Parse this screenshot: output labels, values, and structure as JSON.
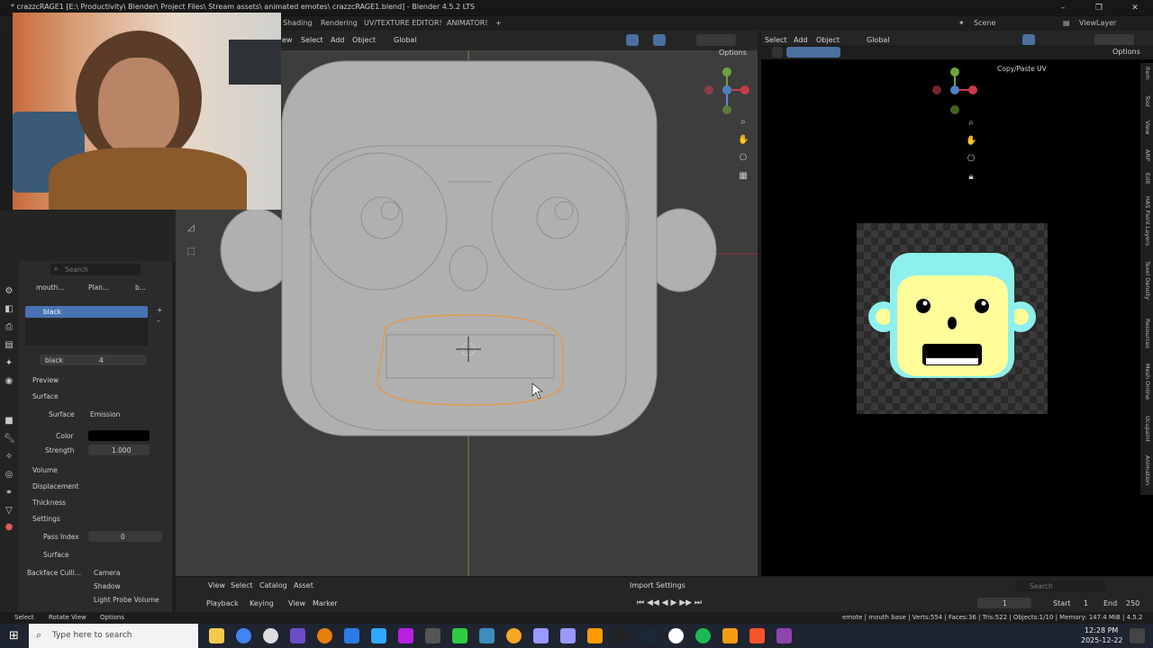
{
  "window": {
    "title": "* crazzcRAGE1 [E:\\ Productivity\\ Blender\\ Project Files\\ Stream assets\\ animated emotes\\ crazzcRAGE1.blend] - Blender 4.5.2 LTS"
  },
  "workspaces": [
    "Shading",
    "Rendering",
    "UV/TEXTURE EDITOR!",
    "ANIMATOR!"
  ],
  "workspace_add": "+",
  "scene": "Scene",
  "view_layer": "ViewLayer",
  "viewport_header": {
    "view": "ew",
    "select": "Select",
    "add": "Add",
    "object": "Object",
    "transform": "Global",
    "options": "Options"
  },
  "uv_header": {
    "select": "Select",
    "add": "Add",
    "object": "Object",
    "transform": "Global",
    "options": "Options",
    "copy_paste": "Copy/Paste UV"
  },
  "right_tabs": [
    "Item",
    "Tool",
    "View",
    "ARP",
    "Edit",
    "HAS Paint Layers",
    "Texel Density",
    "Resources",
    "Mesh Online",
    "Ucupaint",
    "Animation"
  ],
  "properties": {
    "search_placeholder": "Search",
    "breadcrumb": [
      "mouth...",
      "Plan...",
      "b..."
    ],
    "material_slot": "black",
    "material_name": "black",
    "material_users": "4",
    "sections": {
      "preview": "Preview",
      "surface": "Surface",
      "volume": "Volume",
      "displacement": "Displacement",
      "thickness": "Thickness",
      "settings": "Settings",
      "surface_sub": "Surface"
    },
    "surface_label": "Surface",
    "surface_value": "Emission",
    "color_label": "Color",
    "strength_label": "Strength",
    "strength_value": "1.000",
    "pass_index_label": "Pass Index",
    "pass_index_value": "0",
    "backface_label": "Backface Culli...",
    "camera_label": "Camera",
    "shadow_label": "Shadow",
    "light_probe_label": "Light Probe Volume"
  },
  "asset_bar": {
    "view": "View",
    "select": "Select",
    "catalog": "Catalog",
    "asset": "Asset",
    "import_settings": "Import Settings",
    "search_placeholder": "Search"
  },
  "timeline": {
    "playback": "Playback",
    "keying": "Keying",
    "view": "View",
    "marker": "Marker",
    "current_frame": "1",
    "start_label": "Start",
    "start_value": "1",
    "end_label": "End",
    "end_value": "250"
  },
  "status": {
    "select": "Select",
    "rotate": "Rotate View",
    "options": "Options",
    "stats": "emote | mouth base | Verts:554 | Faces:36 | Tris:522 | Objects:1/10 | Memory: 147.4 MiB | 4.5.2"
  },
  "taskbar": {
    "search_placeholder": "Type here to search",
    "time": "12:28 PM",
    "date": "2025-12-22"
  },
  "colors": {
    "accent": "#4772b3",
    "selection_outline": "#e8973a",
    "face_cyan": "#8ef0ec",
    "face_yellow": "#fefd9a"
  }
}
